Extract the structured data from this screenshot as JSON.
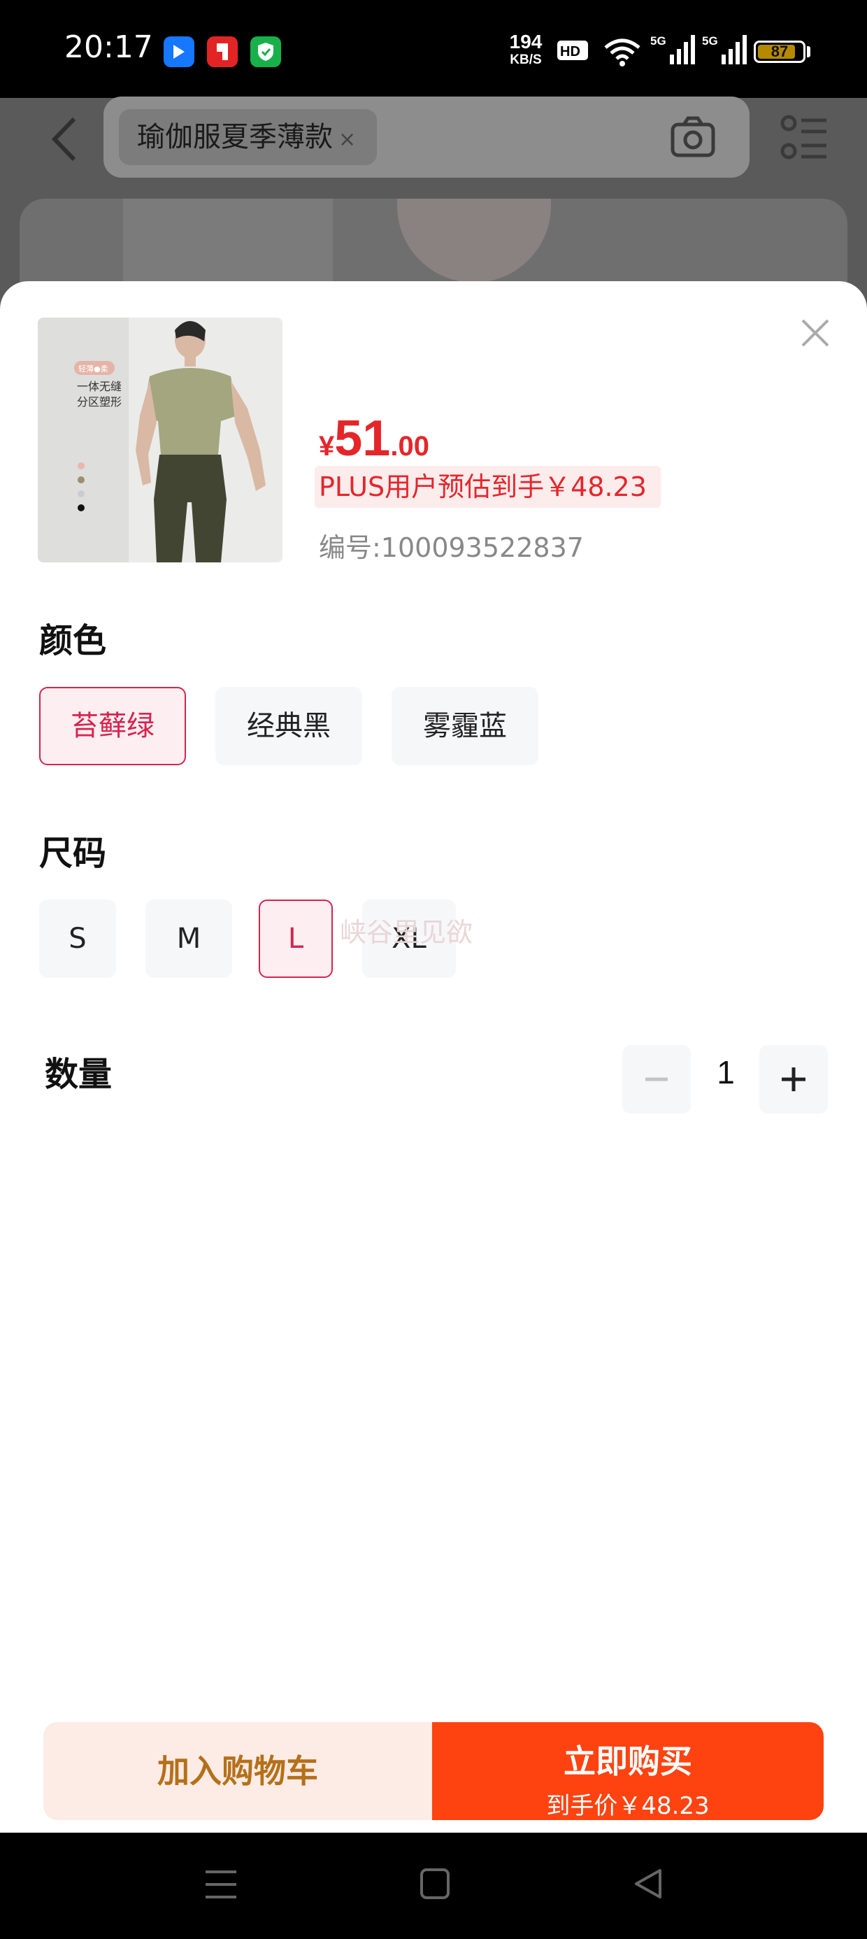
{
  "status_bar": {
    "time": "20:17",
    "net_speed_value": "194",
    "net_speed_unit": "KB/S",
    "hd_badge": "HD",
    "signal_1": "5G",
    "signal_2": "5G",
    "battery": "87",
    "battery_level": 0.87,
    "app_icons": [
      "feather-app-icon",
      "document-app-icon",
      "shield-app-icon"
    ]
  },
  "background_page": {
    "search_chip": "瑜伽服夏季薄款",
    "chip_close": "×"
  },
  "product": {
    "price_symbol": "¥",
    "price_integer": "51",
    "price_decimal": ".00",
    "plus_estimate": "PLUS用户预估到手￥48.23",
    "sku_number": "编号:100093522837",
    "thumb_badge": "轻薄●柔",
    "thumb_caption_1": "一体无缝",
    "thumb_caption_2": "分区塑形",
    "thumb_swatch_colors": [
      "#e8b7ad",
      "#9b8f6c",
      "#c9cdd1",
      "#111111"
    ]
  },
  "color_section": {
    "title": "颜色",
    "options": [
      "苔藓绿",
      "经典黑",
      "雾霾蓝"
    ],
    "selected": "苔藓绿"
  },
  "size_section": {
    "title": "尺码",
    "options": [
      "S",
      "M",
      "L",
      "XL"
    ],
    "selected": "L",
    "watermark": "峡谷里见欲"
  },
  "quantity_section": {
    "title": "数量",
    "value": "1",
    "minus": "−",
    "plus": "+"
  },
  "actions": {
    "add_to_cart": "加入购物车",
    "buy_now": "立即购买",
    "buy_price": "到手价￥48.23"
  },
  "colors": {
    "accent_red": "#e4262b",
    "selected_border": "#d6244d",
    "buy_orange": "#fe4311",
    "cart_bg": "#fdebe5",
    "cart_text": "#b4701a"
  }
}
